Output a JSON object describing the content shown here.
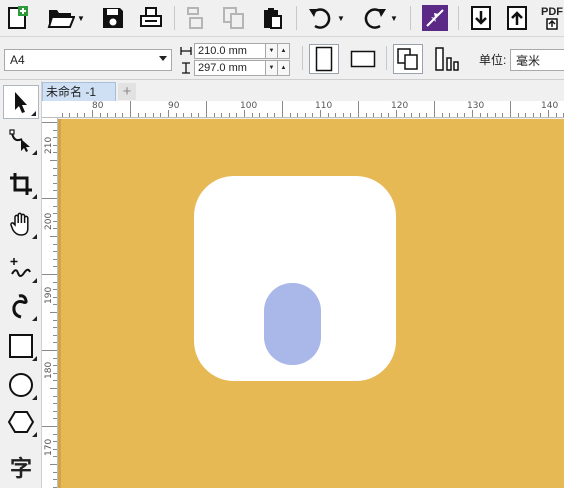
{
  "toolbar": {
    "icons": [
      "new-document-icon",
      "open-folder-icon",
      "save-icon",
      "print-icon",
      "copy-format-icon",
      "paste-format-icon",
      "clipboard-icon",
      "undo-icon",
      "redo-icon",
      "snap-icon",
      "import-icon",
      "export-icon",
      "pdf-icon"
    ],
    "pdf_label": "PDF"
  },
  "propbar": {
    "page_size": "A4",
    "width_value": "210.0 mm",
    "height_value": "297.0 mm",
    "units_label": "单位:",
    "units_value": "毫米"
  },
  "tabs": {
    "document_name": "未命名 -1",
    "add_label": "+"
  },
  "ruler": {
    "horizontal_labels": [
      "80",
      "90",
      "100",
      "110",
      "120",
      "130",
      "140"
    ],
    "vertical_labels": [
      "210",
      "200",
      "190",
      "180",
      "170"
    ]
  },
  "tools": [
    "pick-tool",
    "shape-tool",
    "crop-tool",
    "pan-tool",
    "freehand-tool",
    "artistic-media-tool",
    "rectangle-tool",
    "ellipse-tool",
    "polygon-tool",
    "text-tool"
  ],
  "text_tool_glyph": "字",
  "colors": {
    "canvas": "#e6b955",
    "square": "#ffffff",
    "pill": "#a9b8e8",
    "accent": "#5b2a86"
  }
}
